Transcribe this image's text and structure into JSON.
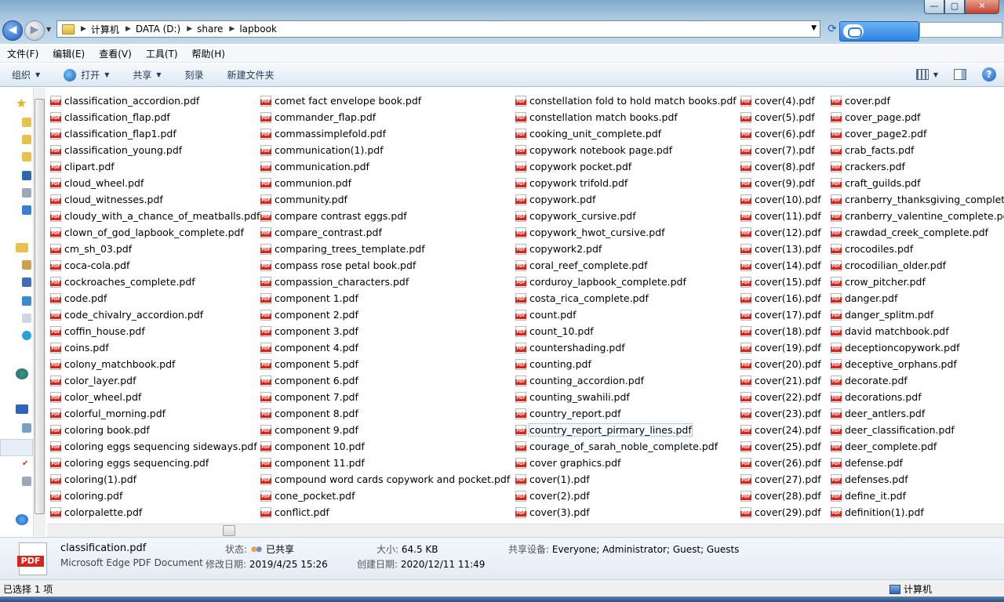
{
  "window": {
    "controls": [
      "—",
      "▢",
      "✕"
    ]
  },
  "address": {
    "crumbs": [
      "计算机",
      "DATA (D:)",
      "share",
      "lapbook"
    ]
  },
  "menu": [
    "文件(F)",
    "编辑(E)",
    "查看(V)",
    "工具(T)",
    "帮助(H)"
  ],
  "commands": {
    "organize": "组织",
    "open": "打开",
    "share": "共享",
    "burn": "刻录",
    "new_folder": "新建文件夹",
    "help": "?"
  },
  "columns": [
    [
      "classification_accordion.pdf",
      "classification_flap.pdf",
      "classification_flap1.pdf",
      "classification_young.pdf",
      "clipart.pdf",
      "cloud_wheel.pdf",
      "cloud_witnesses.pdf",
      "cloudy_with_a_chance_of_meatballs.pdf",
      "clown_of_god_lapbook_complete.pdf",
      "cm_sh_03.pdf",
      "coca-cola.pdf",
      "cockroaches_complete.pdf",
      "code.pdf",
      "code_chivalry_accordion.pdf",
      "coffin_house.pdf",
      "coins.pdf",
      "colony_matchbook.pdf",
      "color_layer.pdf",
      "color_wheel.pdf",
      "colorful_morning.pdf",
      "coloring book.pdf",
      "coloring eggs sequencing sideways.pdf",
      "coloring eggs sequencing.pdf",
      "coloring(1).pdf",
      "coloring.pdf",
      "colorpalette.pdf"
    ],
    [
      "comet fact envelope book.pdf",
      "commander_flap.pdf",
      "commassimplefold.pdf",
      "communication(1).pdf",
      "communication.pdf",
      "communion.pdf",
      "community.pdf",
      "compare contrast eggs.pdf",
      "compare_contrast.pdf",
      "comparing_trees_template.pdf",
      "compass rose petal book.pdf",
      "compassion_characters.pdf",
      "component 1.pdf",
      "component 2.pdf",
      "component 3.pdf",
      "component 4.pdf",
      "component 5.pdf",
      "component 6.pdf",
      "component 7.pdf",
      "component 8.pdf",
      "component 9.pdf",
      "component 10.pdf",
      "component 11.pdf",
      "compound word cards copywork and pocket.pdf",
      "cone_pocket.pdf",
      "conflict.pdf"
    ],
    [
      "constellation fold to hold match books.pdf",
      "constellation match books.pdf",
      "cooking_unit_complete.pdf",
      "copywork notebook page.pdf",
      "copywork pocket.pdf",
      "copywork trifold.pdf",
      "copywork.pdf",
      "copywork_cursive.pdf",
      "copywork_hwot_cursive.pdf",
      "copywork2.pdf",
      "coral_reef_complete.pdf",
      "corduroy_lapbook_complete.pdf",
      "costa_rica_complete.pdf",
      "count.pdf",
      "count_10.pdf",
      "countershading.pdf",
      "counting.pdf",
      "counting_accordion.pdf",
      "counting_swahili.pdf",
      "country_report.pdf",
      "country_report_pirmary_lines.pdf",
      "courage_of_sarah_noble_complete.pdf",
      "cover graphics.pdf",
      "cover(1).pdf",
      "cover(2).pdf",
      "cover(3).pdf"
    ],
    [
      "cover(4).pdf",
      "cover(5).pdf",
      "cover(6).pdf",
      "cover(7).pdf",
      "cover(8).pdf",
      "cover(9).pdf",
      "cover(10).pdf",
      "cover(11).pdf",
      "cover(12).pdf",
      "cover(13).pdf",
      "cover(14).pdf",
      "cover(15).pdf",
      "cover(16).pdf",
      "cover(17).pdf",
      "cover(18).pdf",
      "cover(19).pdf",
      "cover(20).pdf",
      "cover(21).pdf",
      "cover(22).pdf",
      "cover(23).pdf",
      "cover(24).pdf",
      "cover(25).pdf",
      "cover(26).pdf",
      "cover(27).pdf",
      "cover(28).pdf",
      "cover(29).pdf"
    ],
    [
      "cover.pdf",
      "cover_page.pdf",
      "cover_page2.pdf",
      "crab_facts.pdf",
      "crackers.pdf",
      "craft_guilds.pdf",
      "cranberry_thanksgiving_complete.pdf",
      "cranberry_valentine_complete.pdf",
      "crawdad_creek_complete.pdf",
      "crocodiles.pdf",
      "crocodilian_older.pdf",
      "crow_pitcher.pdf",
      "danger.pdf",
      "danger_splitm.pdf",
      "david matchbook.pdf",
      "deceptioncopywork.pdf",
      "deceptive_orphans.pdf",
      "decorate.pdf",
      "decorations.pdf",
      "deer_antlers.pdf",
      "deer_classification.pdf",
      "deer_complete.pdf",
      "defense.pdf",
      "defenses.pdf",
      "define_it.pdf",
      "definition(1).pdf"
    ]
  ],
  "focused_file": "country_report_pirmary_lines.pdf",
  "details": {
    "name": "classification.pdf",
    "type": "Microsoft Edge PDF Document",
    "status_label": "状态:",
    "status_value": "已共享",
    "modified_label": "修改日期:",
    "modified_value": "2019/4/25 15:26",
    "size_label": "大小:",
    "size_value": "64.5 KB",
    "created_label": "创建日期:",
    "created_value": "2020/12/11 11:49",
    "shared_label": "共享设备:",
    "shared_value": "Everyone; Administrator; Guest; Guests",
    "icon_text": "PDF"
  },
  "status": {
    "selected": "已选择 1 项",
    "location": "计算机"
  }
}
